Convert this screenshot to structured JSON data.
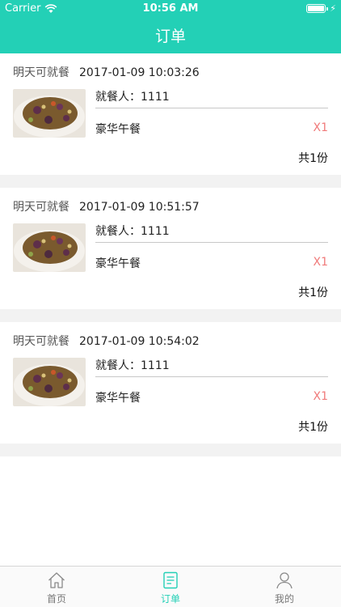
{
  "status_bar": {
    "carrier": "Carrier",
    "time": "10:56 AM"
  },
  "nav": {
    "title": "订单"
  },
  "orders": [
    {
      "status": "明天可就餐",
      "time": "2017-01-09 10:03:26",
      "diner_label": "就餐人：",
      "diner": "1111",
      "meal": "豪华午餐",
      "qty": "X1",
      "total": "共1份"
    },
    {
      "status": "明天可就餐",
      "time": "2017-01-09 10:51:57",
      "diner_label": "就餐人：",
      "diner": "1111",
      "meal": "豪华午餐",
      "qty": "X1",
      "total": "共1份"
    },
    {
      "status": "明天可就餐",
      "time": "2017-01-09 10:54:02",
      "diner_label": "就餐人：",
      "diner": "1111",
      "meal": "豪华午餐",
      "qty": "X1",
      "total": "共1份"
    }
  ],
  "tabbar": {
    "active_color": "#23d0b6",
    "items": [
      {
        "label": "首页",
        "icon": "home-icon"
      },
      {
        "label": "订单",
        "icon": "order-icon"
      },
      {
        "label": "我的",
        "icon": "profile-icon"
      }
    ],
    "active_tab": "订单"
  },
  "colors": {
    "brand": "#23d0b6",
    "quantity": "#f07a7a"
  }
}
